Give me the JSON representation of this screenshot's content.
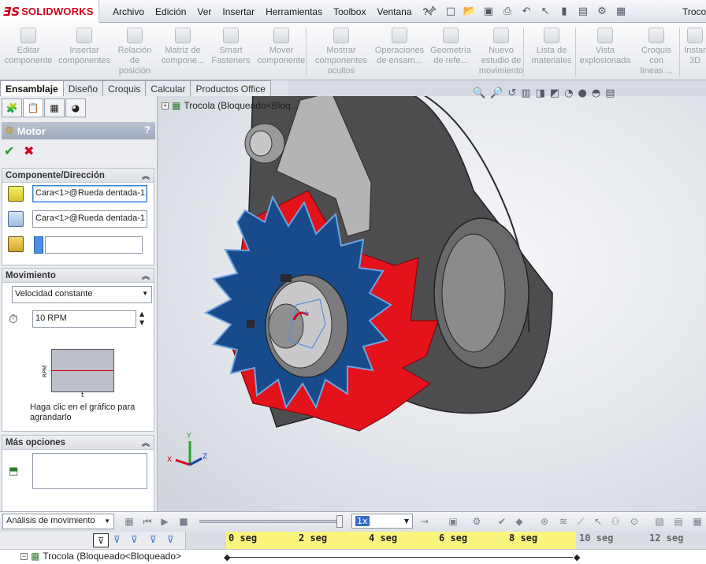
{
  "app": {
    "logo_text": "SOLIDWORKS",
    "document_title": "Troco",
    "brand_color": "#d0021b"
  },
  "menu": [
    "Archivo",
    "Edición",
    "Ver",
    "Insertar",
    "Herramientas",
    "Toolbox",
    "Ventana",
    "?"
  ],
  "command_manager": [
    {
      "label": "Editar componente",
      "icon": "edit-component-icon"
    },
    {
      "label": "Insertar componentes",
      "icon": "insert-components-icon"
    },
    {
      "label": "Relación de posición",
      "icon": "mate-icon"
    },
    {
      "label": "Matriz de compone...",
      "icon": "pattern-icon"
    },
    {
      "label": "Smart Fasteners",
      "icon": "fastener-icon"
    },
    {
      "label": "Mover componente",
      "icon": "move-component-icon"
    },
    {
      "label": "Mostrar componentes ocultos",
      "icon": "show-hidden-icon"
    },
    {
      "label": "Operaciones de ensam...",
      "icon": "assembly-features-icon"
    },
    {
      "label": "Geometría de refe...",
      "icon": "reference-geometry-icon"
    },
    {
      "label": "Nuevo estudio de movimiento",
      "icon": "motion-study-icon"
    },
    {
      "label": "Lista de materiales",
      "icon": "bom-icon"
    },
    {
      "label": "Vista explosionada",
      "icon": "exploded-view-icon"
    },
    {
      "label": "Croquis con líneas ...",
      "icon": "sketch-lines-icon"
    },
    {
      "label": "Instar 3D",
      "icon": "instant3d-icon"
    }
  ],
  "tabs": [
    "Ensamblaje",
    "Diseño",
    "Croquis",
    "Calcular",
    "Productos Office"
  ],
  "property_manager": {
    "title": "Motor",
    "help": "?",
    "group_component": {
      "title": "Componente/Dirección",
      "face_1": "Cara<1>@Rueda dentada-1",
      "face_2": "Cara<1>@Rueda dentada-1"
    },
    "group_motion": {
      "title": "Movimiento",
      "motion_type": "Velocidad constante",
      "speed": "10 RPM",
      "graph_ylabel": "RPM",
      "graph_xlabel": "t",
      "graph_hint": "Haga clic en el gráfico para agrandarlo"
    },
    "group_more": {
      "title": "Más opciones"
    }
  },
  "viewport": {
    "tree_item": "Trocola  (Bloqueado<Bloq...",
    "triad_labels": [
      "X",
      "Y",
      "Z"
    ]
  },
  "motion_manager": {
    "study_type": "Análisis de movimiento",
    "playback_speed": "1x",
    "ticks": [
      "0 seg",
      "2 seg",
      "4 seg",
      "6 seg",
      "8 seg",
      "10 seg",
      "12 seg"
    ],
    "row_label": "Trocola  (Bloqueado<Bloqueado>"
  }
}
